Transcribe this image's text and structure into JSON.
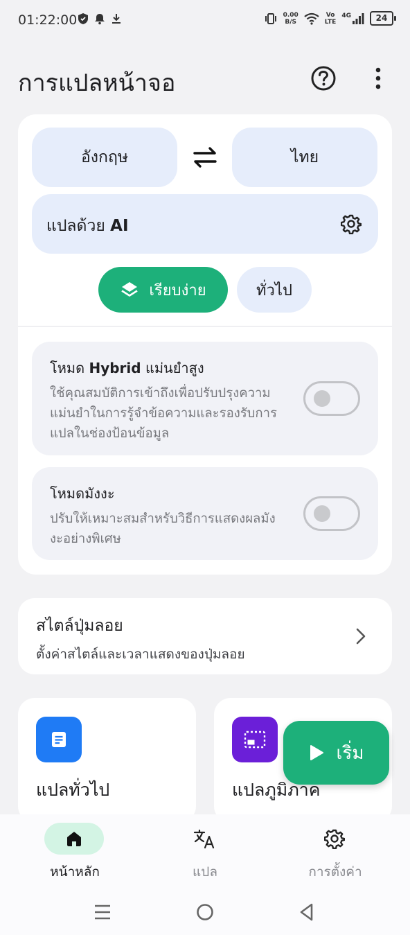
{
  "status_bar": {
    "time": "01:22:00",
    "net_speed_value": "0.00",
    "net_speed_unit": "B/S",
    "volte_top": "Vo",
    "volte_bottom": "LTE",
    "network": "4G",
    "battery": "24"
  },
  "header": {
    "title": "การแปลหน้าจอ"
  },
  "languages": {
    "source": "อังกฤษ",
    "target": "ไทย"
  },
  "engine": {
    "label_prefix": "แปลด้วย ",
    "label_bold": "AI"
  },
  "modes": {
    "simple": "เรียบง่าย",
    "general": "ทั่วไป",
    "selected": "simple"
  },
  "options": {
    "hybrid": {
      "title_prefix": "โหมด ",
      "title_bold": "Hybrid",
      "title_suffix": " แม่นยำสูง",
      "desc": "ใช้คุณสมบัติการเข้าถึงเพื่อปรับปรุงความแม่นยำในการรู้จำข้อความและรองรับการแปลในช่องป้อนข้อมูล",
      "enabled": false
    },
    "manga": {
      "title": "โหมดมังงะ",
      "desc": "ปรับให้เหมาะสมสำหรับวิธีการแสดงผลมังงะอย่างพิเศษ",
      "enabled": false
    }
  },
  "floating_style": {
    "title": "สไตล์ปุ่มลอย",
    "desc": "ตั้งค่าสไตล์และเวลาแสดงของปุ่มลอย"
  },
  "features": {
    "general": {
      "title": "แปลทั่วไป",
      "icon": "document-icon",
      "color": "#1f7bf5"
    },
    "region": {
      "title": "แปลภูมิภาค",
      "icon": "region-select-icon",
      "color": "#6b1fd8"
    }
  },
  "fab": {
    "label": "เริ่ม"
  },
  "bottom_nav": {
    "items": [
      {
        "label": "หน้าหลัก",
        "icon": "home-icon",
        "active": true
      },
      {
        "label": "แปล",
        "icon": "translate-icon",
        "active": false
      },
      {
        "label": "การตั้งค่า",
        "icon": "settings-icon",
        "active": false
      }
    ]
  },
  "colors": {
    "accent": "#1db07a",
    "chip_bg": "#e6edfb",
    "background": "#f2f2f4"
  }
}
